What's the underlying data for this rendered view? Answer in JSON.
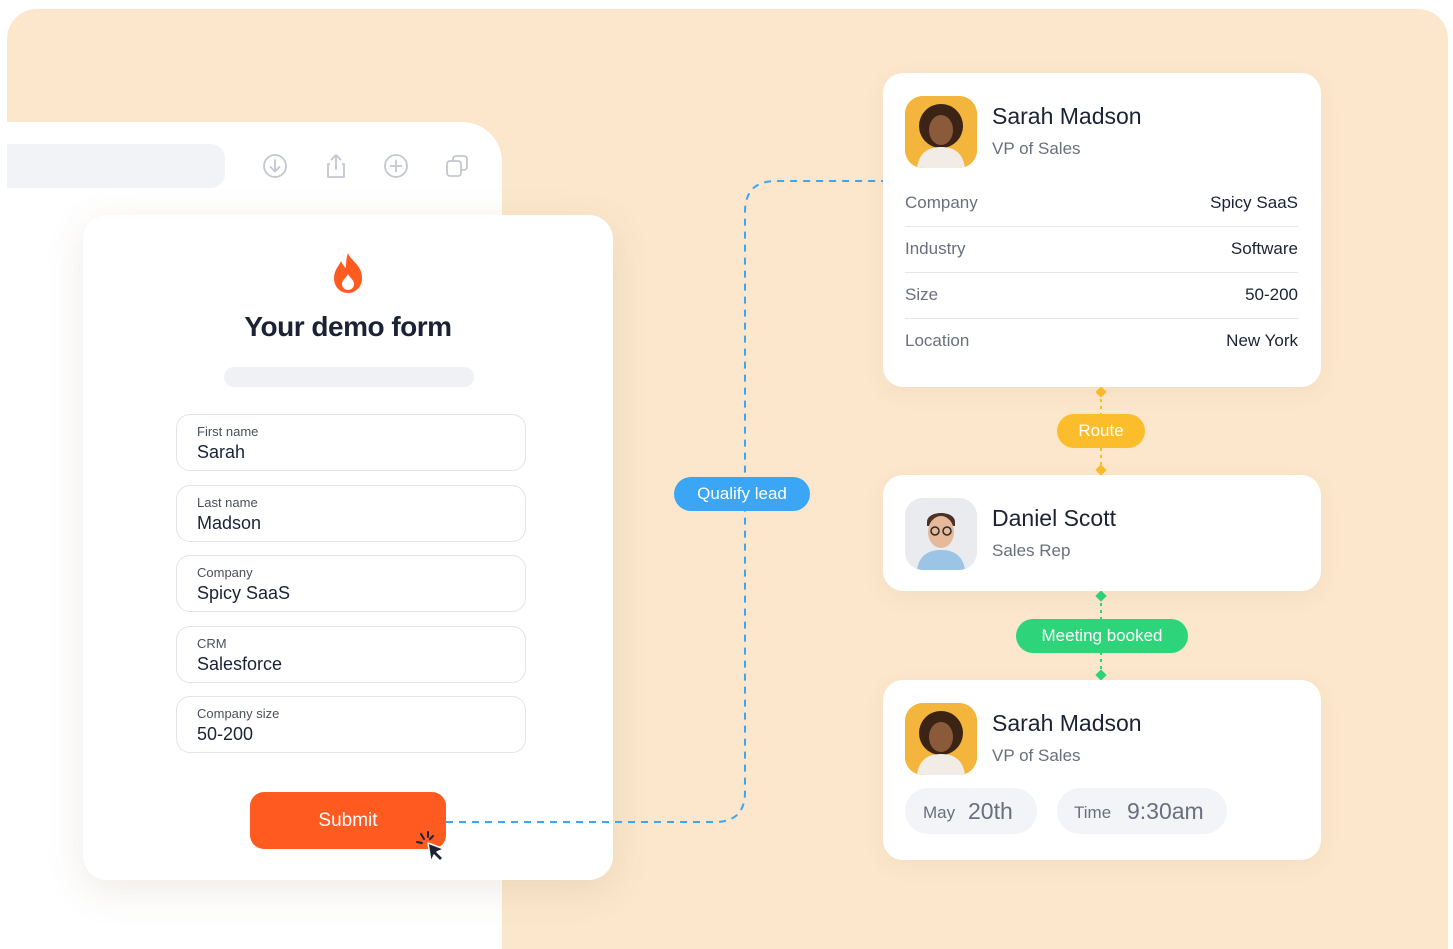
{
  "browser": {
    "toolbar_icons": [
      "download-icon",
      "share-icon",
      "add-icon",
      "copy-icon"
    ]
  },
  "form": {
    "logo_icon": "flame-icon",
    "title": "Your demo form",
    "fields": [
      {
        "label": "First name",
        "value": "Sarah"
      },
      {
        "label": "Last name",
        "value": "Madson"
      },
      {
        "label": "Company",
        "value": "Spicy SaaS"
      },
      {
        "label": "CRM",
        "value": "Salesforce"
      },
      {
        "label": "Company size",
        "value": "50-200"
      }
    ],
    "submit_label": "Submit"
  },
  "flow": {
    "qualify_label": "Qualify lead",
    "route_label": "Route",
    "meeting_label": "Meeting booked",
    "colors": {
      "qualify": "#3aa6f5",
      "route": "#fbbd2c",
      "meeting": "#2ed47a",
      "accent": "#ff5a1f"
    }
  },
  "lead_card": {
    "name": "Sarah Madson",
    "role": "VP of Sales",
    "details": [
      {
        "key": "Company",
        "value": "Spicy SaaS"
      },
      {
        "key": "Industry",
        "value": "Software"
      },
      {
        "key": "Size",
        "value": "50-200"
      },
      {
        "key": "Location",
        "value": "New York"
      }
    ]
  },
  "rep_card": {
    "name": "Daniel Scott",
    "role": "Sales Rep"
  },
  "meeting_card": {
    "name": "Sarah Madson",
    "role": "VP of Sales",
    "date_key": "May",
    "date_value": "20th",
    "time_key": "Time",
    "time_value": "9:30am"
  }
}
